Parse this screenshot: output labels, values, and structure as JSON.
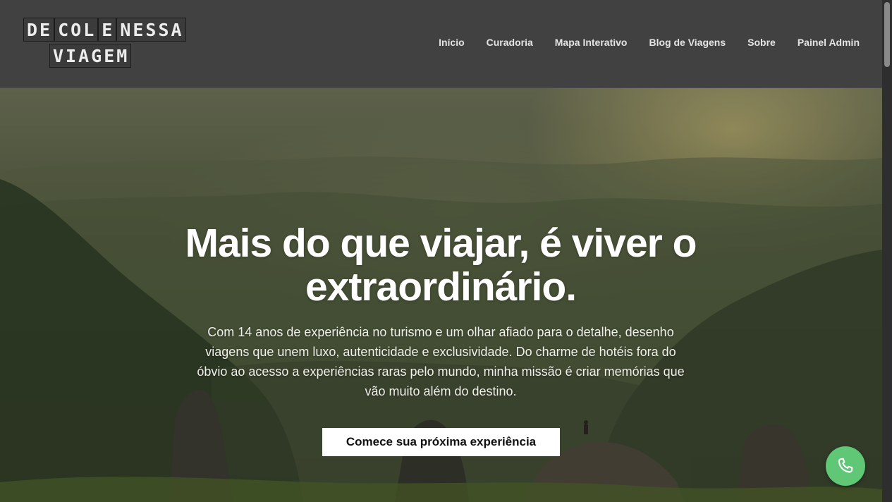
{
  "logo": {
    "line1": [
      "DE",
      "COL",
      "E",
      "NESSA"
    ],
    "line2": "VIAGEM"
  },
  "nav": {
    "items": [
      "Início",
      "Curadoria",
      "Mapa Interativo",
      "Blog de Viagens",
      "Sobre",
      "Painel Admin"
    ]
  },
  "hero": {
    "title_line1": "Mais do que viajar, é viver o",
    "title_line2": "extraordinário.",
    "text_line1": "Com 14 anos de experiência no turismo e um olhar afiado para o detalhe, desenho",
    "text_line2": "viagens que unem luxo, autenticidade e exclusividade. Do charme de hotéis fora do",
    "text_line3": "óbvio ao acesso a experiências raras pelo mundo, minha missão é criar memórias que",
    "text_line4": "vão muito além do destino.",
    "cta_label": "Comece sua próxima experiência"
  },
  "floating": {
    "contact_icon": "phone-icon",
    "contact_color": "#5fc776"
  },
  "colors": {
    "header_bg": "#414141",
    "cta_bg": "#ffffff"
  }
}
